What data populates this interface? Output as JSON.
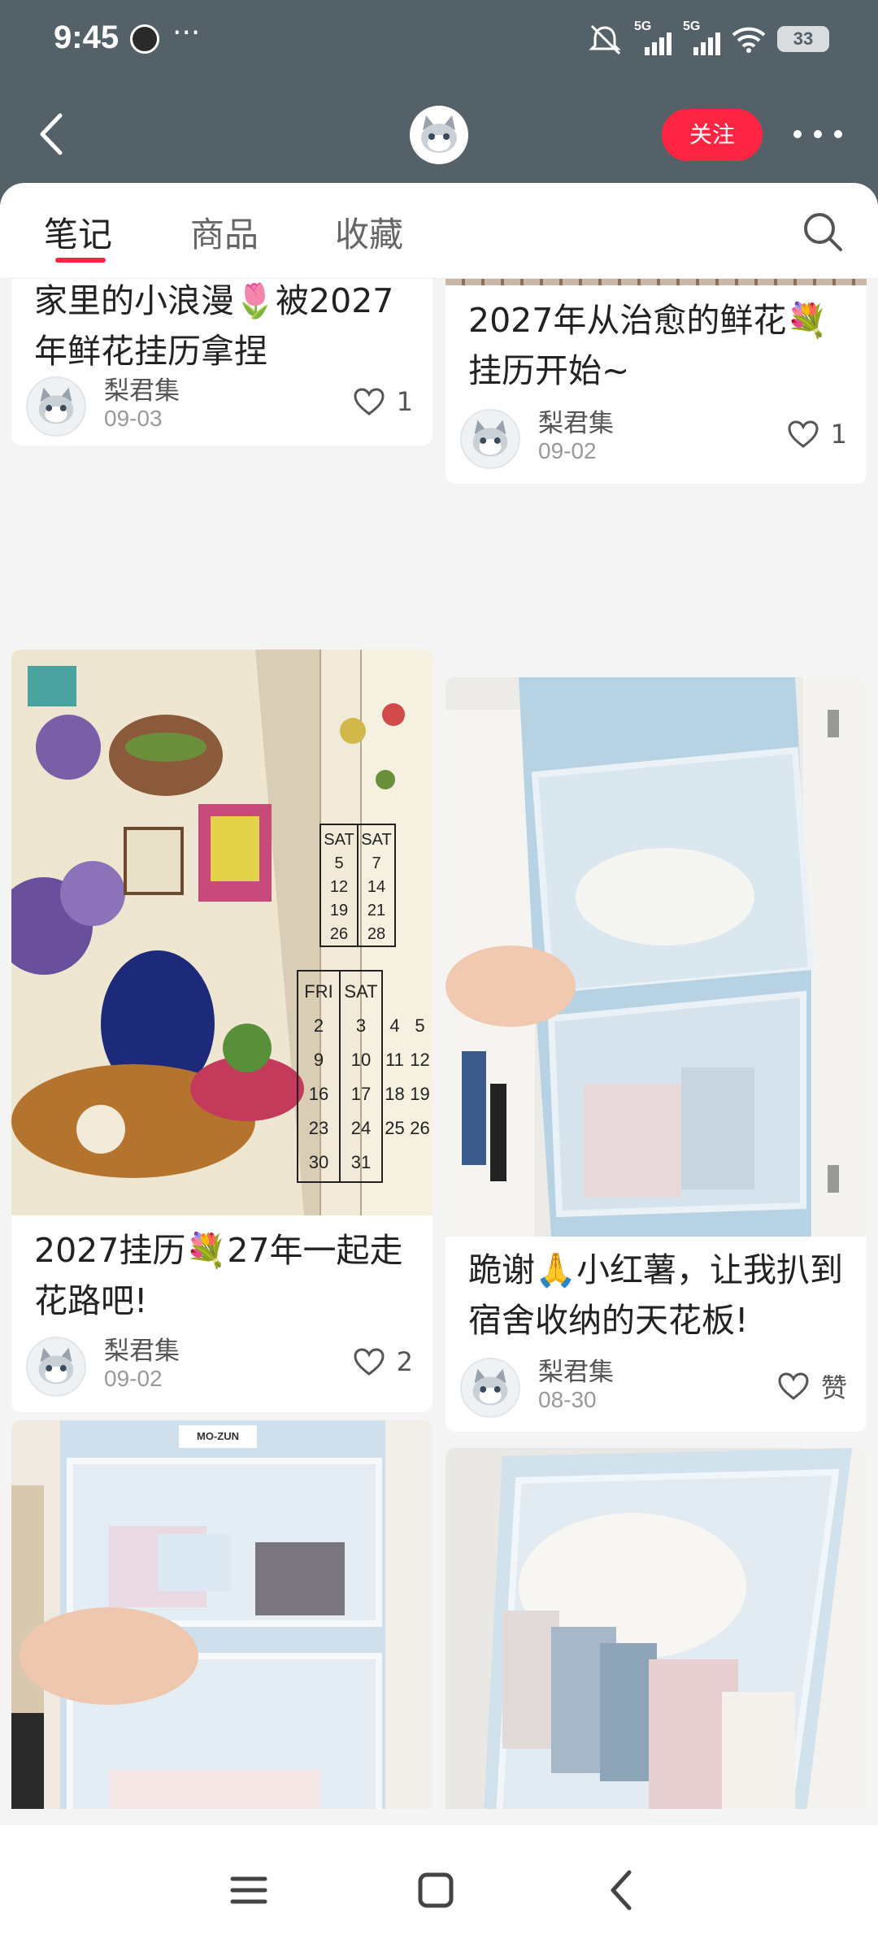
{
  "status": {
    "time": "9:45",
    "dots": "···",
    "network_label": "5G",
    "battery": "33"
  },
  "header": {
    "follow_label": "关注"
  },
  "tabs": [
    {
      "label": "笔记"
    },
    {
      "label": "商品"
    },
    {
      "label": "收藏"
    }
  ],
  "cards": [
    {
      "title": "家里的小浪漫🌷被2027年鲜花挂历拿捏",
      "author": "梨君集",
      "date": "09-03",
      "likes": "1"
    },
    {
      "title": "2027年从治愈的鲜花💐挂历开始~",
      "author": "梨君集",
      "date": "09-02",
      "likes": "1"
    },
    {
      "title": "2027挂历💐27年一起走花路吧!",
      "author": "梨君集",
      "date": "09-02",
      "likes": "2"
    },
    {
      "title": "跪谢🙏小红薯，让我扒到宿舍收纳的天花板!",
      "author": "梨君集",
      "date": "08-30",
      "likes": "赞"
    }
  ],
  "images": {
    "calendar_days_1": [
      "SAT",
      "5",
      "12",
      "19",
      "26"
    ],
    "calendar_days_2": [
      "SAT",
      "7",
      "14",
      "21",
      "28"
    ],
    "calendar_days_3": [
      "FRI",
      "SAT",
      "2",
      "3",
      "9",
      "10",
      "16",
      "17",
      "23",
      "24",
      "30",
      "31"
    ],
    "calendar_days_4": [
      "4",
      "5",
      "11",
      "12",
      "18",
      "19",
      "25",
      "26"
    ],
    "brand_tag": "MO-ZUN"
  },
  "colors": {
    "accent": "#ff2442",
    "header_bg": "#546169"
  }
}
